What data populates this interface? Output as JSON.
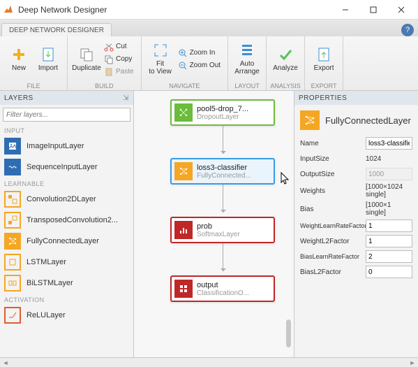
{
  "window": {
    "title": "Deep Network Designer"
  },
  "ribbon": {
    "tab": "DEEP NETWORK DESIGNER",
    "groups": {
      "file": {
        "label": "FILE",
        "new": "New",
        "import": "Import"
      },
      "build": {
        "label": "BUILD",
        "duplicate": "Duplicate",
        "cut": "Cut",
        "copy": "Copy",
        "paste": "Paste"
      },
      "navigate": {
        "label": "NAVIGATE",
        "fit": "Fit\nto View",
        "zoomIn": "Zoom In",
        "zoomOut": "Zoom Out"
      },
      "layout": {
        "label": "LAYOUT",
        "auto": "Auto\nArrange"
      },
      "analysis": {
        "label": "ANALYSIS",
        "analyze": "Analyze"
      },
      "export": {
        "label": "EXPORT",
        "export": "Export"
      }
    }
  },
  "layers": {
    "header": "LAYERS",
    "filterPlaceholder": "Filter layers...",
    "cats": {
      "input": "INPUT",
      "learnable": "LEARNABLE",
      "activation": "ACTIVATION"
    },
    "items": {
      "imageInput": "ImageInputLayer",
      "sequenceInput": "SequenceInputLayer",
      "conv2d": "Convolution2DLayer",
      "tconv2d": "TransposedConvolution2...",
      "fc": "FullyConnectedLayer",
      "lstm": "LSTMLayer",
      "bilstm": "BiLSTMLayer",
      "relu": "ReLULayer"
    }
  },
  "canvas": {
    "nodes": [
      {
        "name": "pool5-drop_7...",
        "type": "DropoutLayer",
        "color": "#6cbb3c"
      },
      {
        "name": "loss3-classifier",
        "type": "FullyConnected...",
        "color": "#f5a623",
        "selected": true
      },
      {
        "name": "prob",
        "type": "SoftmaxLayer",
        "color": "#c02727"
      },
      {
        "name": "output",
        "type": "ClassificationO...",
        "color": "#c02727"
      }
    ]
  },
  "properties": {
    "header": "PROPERTIES",
    "title": "FullyConnectedLayer",
    "rows": {
      "name": {
        "label": "Name",
        "value": "loss3-classifier"
      },
      "inputSize": {
        "label": "InputSize",
        "value": "1024"
      },
      "outputSize": {
        "label": "OutputSize",
        "value": "1000"
      },
      "weights": {
        "label": "Weights",
        "value": "[1000×1024 single]"
      },
      "bias": {
        "label": "Bias",
        "value": "[1000×1 single]"
      },
      "wlr": {
        "label": "WeightLearnRateFactor",
        "value": "1"
      },
      "wl2": {
        "label": "WeightL2Factor",
        "value": "1"
      },
      "blr": {
        "label": "BiasLearnRateFactor",
        "value": "2"
      },
      "bl2": {
        "label": "BiasL2Factor",
        "value": "0"
      }
    }
  }
}
